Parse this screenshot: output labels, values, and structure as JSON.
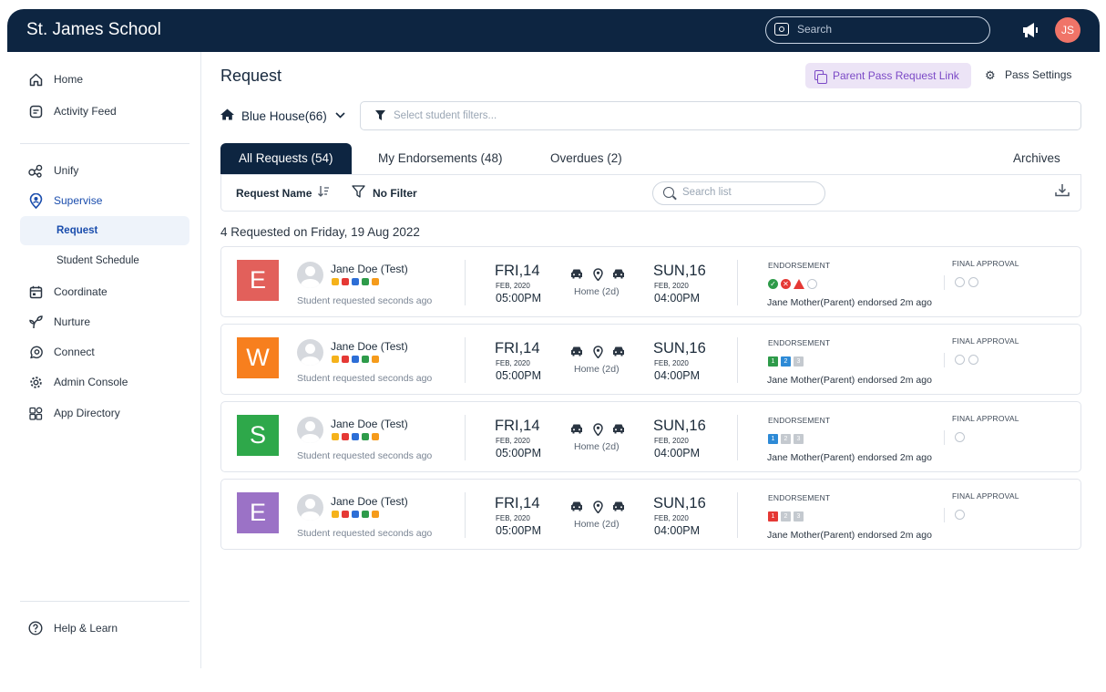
{
  "topbar": {
    "title": "St. James School",
    "search_placeholder": "Search",
    "avatar_initials": "JS",
    "avatar_color": "#f07468",
    "bg_color": "#0d2541"
  },
  "sidebar": {
    "items": [
      {
        "label": "Home",
        "icon": "home-icon"
      },
      {
        "label": "Activity Feed",
        "icon": "feed-icon"
      },
      {
        "label": "Unify",
        "icon": "unify-icon"
      },
      {
        "label": "Supervise",
        "icon": "supervise-icon"
      },
      {
        "label": "Request",
        "icon": ""
      },
      {
        "label": "Student Schedule",
        "icon": ""
      },
      {
        "label": "Coordinate",
        "icon": "calendar-icon"
      },
      {
        "label": "Nurture",
        "icon": "sprout-icon"
      },
      {
        "label": "Connect",
        "icon": "connect-icon"
      },
      {
        "label": "Admin Console",
        "icon": "gear-icon"
      },
      {
        "label": "App Directory",
        "icon": "apps-icon"
      }
    ],
    "help_label": "Help & Learn"
  },
  "main": {
    "title": "Request",
    "parent_pass_link_label": "Parent Pass Request Link",
    "pass_settings_label": "Pass Settings",
    "house_label": "Blue House(66)",
    "filter_placeholder": "Select student filters...",
    "tabs": [
      {
        "label": "All Requests (54)",
        "active": true
      },
      {
        "label": "My Endorsements (48)",
        "active": false
      },
      {
        "label": "Overdues (2)",
        "active": false
      },
      {
        "label": "Archives",
        "active": false
      }
    ],
    "toolbar": {
      "sort_label": "Request Name",
      "filter_label": "No Filter",
      "search_placeholder": "Search list"
    },
    "date_header": "4 Requested on Friday, 19 Aug 2022",
    "requests": [
      {
        "letter": "E",
        "color": "#e2605b",
        "name": "Jane Doe (Test)",
        "requested": "Student requested seconds ago",
        "start_day": "FRI,14",
        "start_month": "FEB, 2020",
        "start_time": "05:00PM",
        "destination": "Home (2d)",
        "end_day": "SUN,16",
        "end_month": "FEB, 2020",
        "end_time": "04:00PM",
        "endorsement_label": "ENDORSEMENT",
        "endorsement_style": "status",
        "endorsement_text": "Jane Mother(Parent) endorsed 2m ago",
        "final_label": "FINAL APPROVAL",
        "final_circles": 2
      },
      {
        "letter": "W",
        "color": "#f77f1e",
        "name": "Jane Doe (Test)",
        "requested": "Student requested seconds ago",
        "start_day": "FRI,14",
        "start_month": "FEB, 2020",
        "start_time": "05:00PM",
        "destination": "Home (2d)",
        "end_day": "SUN,16",
        "end_month": "FEB, 2020",
        "end_time": "04:00PM",
        "endorsement_label": "ENDORSEMENT",
        "endorsement_style": "steps",
        "steps": [
          {
            "n": "1",
            "color": "#2e9b4a"
          },
          {
            "n": "2",
            "color": "#2d8ad6"
          },
          {
            "n": "3",
            "color": "#c4c9cf"
          }
        ],
        "endorsement_text": "Jane Mother(Parent) endorsed 2m ago",
        "final_label": "FINAL APPROVAL",
        "final_circles": 2
      },
      {
        "letter": "S",
        "color": "#2ea84a",
        "name": "Jane Doe (Test)",
        "requested": "Student requested seconds ago",
        "start_day": "FRI,14",
        "start_month": "FEB, 2020",
        "start_time": "05:00PM",
        "destination": "Home (2d)",
        "end_day": "SUN,16",
        "end_month": "FEB, 2020",
        "end_time": "04:00PM",
        "endorsement_label": "ENDORSEMENT",
        "endorsement_style": "steps",
        "steps": [
          {
            "n": "1",
            "color": "#2d8ad6"
          },
          {
            "n": "2",
            "color": "#c4c9cf"
          },
          {
            "n": "3",
            "color": "#c4c9cf"
          }
        ],
        "endorsement_text": "Jane Mother(Parent) endorsed 2m ago",
        "final_label": "FINAL APPROVAL",
        "final_circles": 1
      },
      {
        "letter": "E",
        "color": "#9b72c6",
        "name": "Jane Doe (Test)",
        "requested": "Student requested seconds ago",
        "start_day": "FRI,14",
        "start_month": "FEB, 2020",
        "start_time": "05:00PM",
        "destination": "Home (2d)",
        "end_day": "SUN,16",
        "end_month": "FEB, 2020",
        "end_time": "04:00PM",
        "endorsement_label": "ENDORSEMENT",
        "endorsement_style": "steps",
        "steps": [
          {
            "n": "1",
            "color": "#e53935"
          },
          {
            "n": "2",
            "color": "#c4c9cf"
          },
          {
            "n": "3",
            "color": "#c4c9cf"
          }
        ],
        "endorsement_text": "Jane Mother(Parent) endorsed 2m ago",
        "final_label": "FINAL APPROVAL",
        "final_circles": 1
      }
    ],
    "student_badge_colors": [
      "#f5b21b",
      "#e53935",
      "#2d6ed6",
      "#2e9b4a",
      "#f59b1b"
    ],
    "status_colors": {
      "approved": "#2e9b4a",
      "rejected": "#e53935",
      "warning": "#e53935"
    }
  }
}
